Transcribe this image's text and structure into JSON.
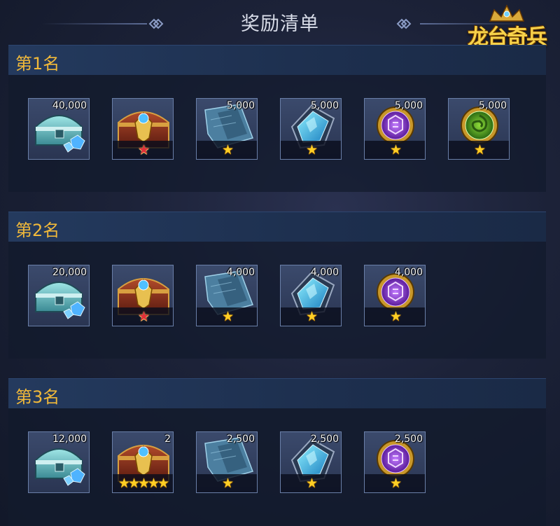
{
  "header": {
    "title": "奖励清单",
    "logo_text": "龙台奇兵"
  },
  "colors": {
    "accent_gold": "#f1b93a",
    "star_gold": "#ffcf25",
    "star_red": "#e0303a"
  },
  "sections": [
    {
      "rank_label": "第1名",
      "items": [
        {
          "icon": "silver-chest-icon",
          "quantity": "40,000",
          "stars": ""
        },
        {
          "icon": "red-treasure-chest-icon",
          "quantity": "",
          "stars": "★"
        },
        {
          "icon": "blue-scroll-fragment-icon",
          "quantity": "5,000",
          "stars": "★"
        },
        {
          "icon": "blue-crystal-icon",
          "quantity": "5,000",
          "stars": "★"
        },
        {
          "icon": "purple-medal-icon",
          "quantity": "5,000",
          "stars": "★"
        },
        {
          "icon": "green-orb-icon",
          "quantity": "5,000",
          "stars": "★"
        }
      ]
    },
    {
      "rank_label": "第2名",
      "items": [
        {
          "icon": "silver-chest-icon",
          "quantity": "20,000",
          "stars": ""
        },
        {
          "icon": "red-treasure-chest-icon",
          "quantity": "",
          "stars": "★"
        },
        {
          "icon": "blue-scroll-fragment-icon",
          "quantity": "4,000",
          "stars": "★"
        },
        {
          "icon": "blue-crystal-icon",
          "quantity": "4,000",
          "stars": "★"
        },
        {
          "icon": "purple-medal-icon",
          "quantity": "4,000",
          "stars": "★"
        }
      ]
    },
    {
      "rank_label": "第3名",
      "items": [
        {
          "icon": "silver-chest-icon",
          "quantity": "12,000",
          "stars": ""
        },
        {
          "icon": "red-treasure-chest-icon",
          "quantity": "2",
          "stars": "★★★★★"
        },
        {
          "icon": "blue-scroll-fragment-icon",
          "quantity": "2,500",
          "stars": "★"
        },
        {
          "icon": "blue-crystal-icon",
          "quantity": "2,500",
          "stars": "★"
        },
        {
          "icon": "purple-medal-icon",
          "quantity": "2,500",
          "stars": "★"
        }
      ]
    }
  ]
}
